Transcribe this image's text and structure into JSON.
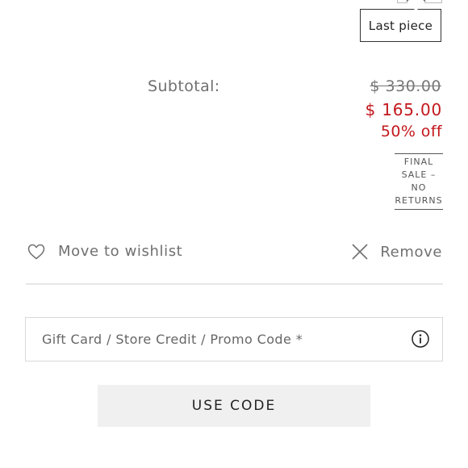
{
  "tooltip": {
    "text": "Last piece"
  },
  "summary": {
    "subtotal_label": "Subtotal:",
    "original_price": "$ 330.00",
    "sale_price": "$ 165.00",
    "discount": "50% off",
    "final_sale_lines": [
      "FINAL",
      "SALE –",
      "NO",
      "RETURNS"
    ]
  },
  "actions": {
    "wishlist_label": "Move to wishlist",
    "wishlist_icon": "heart-icon",
    "remove_label": "Remove",
    "remove_icon": "close-icon"
  },
  "promo": {
    "placeholder": "Gift Card / Store Credit / Promo Code *",
    "value": "",
    "info_icon": "info-icon"
  },
  "buttons": {
    "use_code_label": "USE CODE"
  },
  "colors": {
    "sale_red": "#c3171d",
    "text_gray": "#707070",
    "button_bg": "#f0f0f0"
  }
}
